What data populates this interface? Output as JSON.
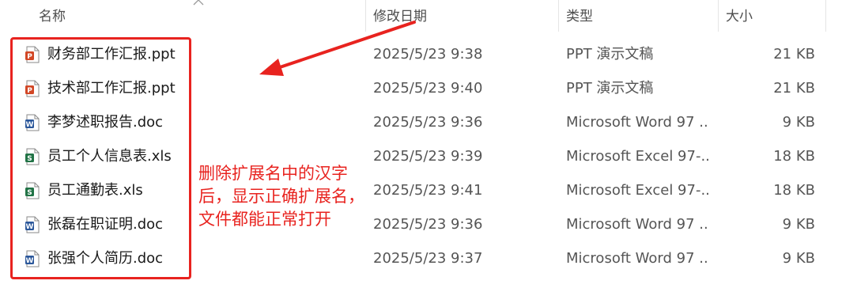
{
  "header": {
    "col_name": "名称",
    "col_date": "修改日期",
    "col_type": "类型",
    "col_size": "大小"
  },
  "files": [
    {
      "name": "财务部工作汇报.ppt",
      "date": "2025/5/23 9:38",
      "type": "PPT 演示文稿",
      "size": "21 KB",
      "icon": "ppt-icon"
    },
    {
      "name": "技术部工作汇报.ppt",
      "date": "2025/5/23 9:40",
      "type": "PPT 演示文稿",
      "size": "21 KB",
      "icon": "ppt-icon"
    },
    {
      "name": "李梦述职报告.doc",
      "date": "2025/5/23 9:36",
      "type": "Microsoft Word 97 ...",
      "size": "9 KB",
      "icon": "word-icon"
    },
    {
      "name": "员工个人信息表.xls",
      "date": "2025/5/23 9:39",
      "type": "Microsoft Excel 97-...",
      "size": "18 KB",
      "icon": "excel-icon"
    },
    {
      "name": "员工通勤表.xls",
      "date": "2025/5/23 9:41",
      "type": "Microsoft Excel 97-...",
      "size": "18 KB",
      "icon": "excel-icon"
    },
    {
      "name": "张磊在职证明.doc",
      "date": "2025/5/23 9:36",
      "type": "Microsoft Word 97 ...",
      "size": "9 KB",
      "icon": "word-icon"
    },
    {
      "name": "张强个人简历.doc",
      "date": "2025/5/23 9:37",
      "type": "Microsoft Word 97 ...",
      "size": "9 KB",
      "icon": "word-icon"
    }
  ],
  "annotation": {
    "text": "删除扩展名中的汉字\n后，显示正确扩展名，\n文件都能正常打开"
  },
  "colors": {
    "annotation_red": "#e8231f",
    "ppt_orange": "#d24726",
    "word_blue": "#2b579a",
    "excel_green": "#217346"
  }
}
